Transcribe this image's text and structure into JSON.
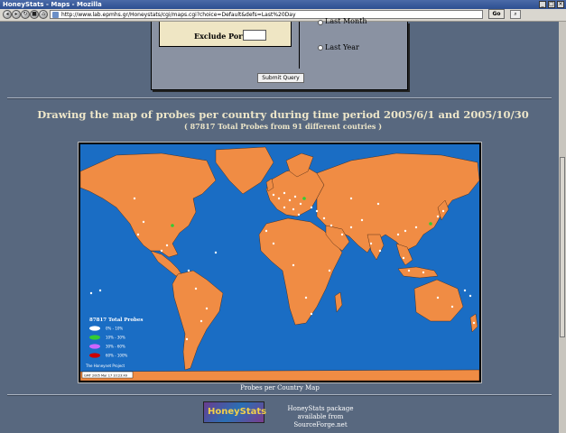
{
  "window": {
    "title": "HoneyStats - Maps - Mozilla",
    "controls": [
      "minimize-icon",
      "maximize-icon",
      "close-icon"
    ]
  },
  "navbar": {
    "url": "http://www.lab.epmhs.gr/Honeystats/cgi/maps.cgi?choice=Default&defs=Last%20Day",
    "go_label": "Go",
    "buttons": [
      "back-icon",
      "forward-icon",
      "reload-icon",
      "stop-icon",
      "home-icon"
    ]
  },
  "form": {
    "exclude_port_label": "Exclude Port",
    "exclude_port_value": "",
    "radio_last_month": "Last Month",
    "radio_last_year": "Last Year",
    "submit_label": "Submit Query"
  },
  "page": {
    "heading": "Drawing the map of probes per country during time period 2005/6/1 and 2005/10/30",
    "subheading": "( 87817 Total Probes from 91 different coutries )",
    "map_caption": "Probes per Country Map"
  },
  "legend": {
    "title": "87817 Total Probes",
    "items": [
      {
        "label": "0% - 10%",
        "color": "#ffffff"
      },
      {
        "label": "10% - 30%",
        "color": "#33cc33"
      },
      {
        "label": "30% - 60%",
        "color": "#cc66ff"
      },
      {
        "label": "60% - 100%",
        "color": "#cc0000"
      }
    ],
    "credit": "The Honeynet Project",
    "stamp": "GMT 2005 Mar 17 10:23:49"
  },
  "footer": {
    "logo_text": "HoneyStats",
    "line1": "HoneyStats package",
    "line2": "available from SourceForge.net"
  },
  "colors": {
    "page_bg": "#58687f",
    "ocean": "#1a6dc4",
    "land": "#f08c44",
    "heading": "#ede6c9"
  }
}
